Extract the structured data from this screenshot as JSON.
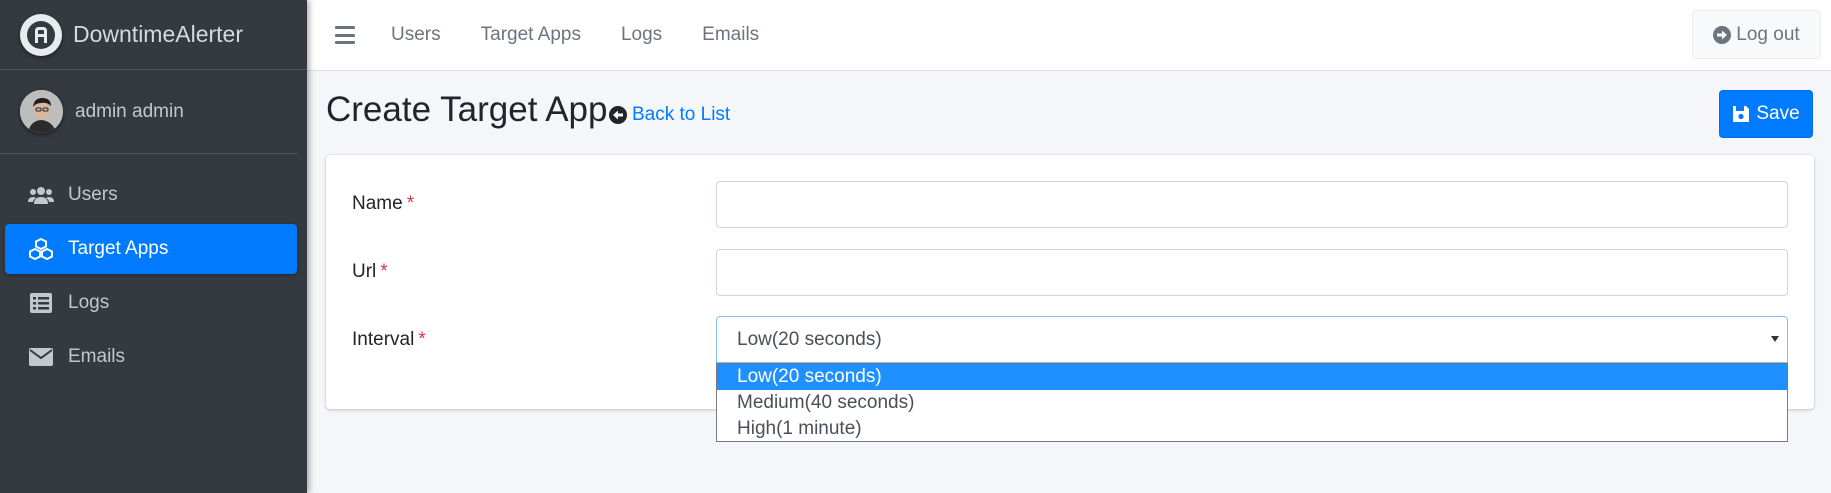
{
  "brand": {
    "name": "DowntimeAlerter",
    "logo_icon": "logo-icon"
  },
  "user": {
    "name": "admin admin",
    "avatar_icon": "avatar-photo"
  },
  "sidebar": {
    "items": [
      {
        "label": "Users",
        "icon": "users-icon",
        "active": false
      },
      {
        "label": "Target Apps",
        "icon": "cubes-icon",
        "active": true
      },
      {
        "label": "Logs",
        "icon": "list-icon",
        "active": false
      },
      {
        "label": "Emails",
        "icon": "envelope-icon",
        "active": false
      }
    ]
  },
  "topbar": {
    "links": [
      "Users",
      "Target Apps",
      "Logs",
      "Emails"
    ],
    "logout_label": "Log out"
  },
  "page": {
    "title": "Create Target App",
    "back_label": "Back to List",
    "save_label": "Save"
  },
  "form": {
    "name": {
      "label": "Name",
      "required_mark": "*",
      "value": ""
    },
    "url": {
      "label": "Url",
      "required_mark": "*",
      "value": ""
    },
    "interval": {
      "label": "Interval",
      "required_mark": "*",
      "selected": "Low(20 seconds)",
      "options": [
        "Low(20 seconds)",
        "Medium(40 seconds)",
        "High(1 minute)"
      ],
      "highlighted_index": 0
    }
  },
  "colors": {
    "sidebar_bg": "#343a40",
    "primary": "#007bff",
    "required": "#dc3545",
    "dropdown_highlight": "#1e90ff"
  }
}
